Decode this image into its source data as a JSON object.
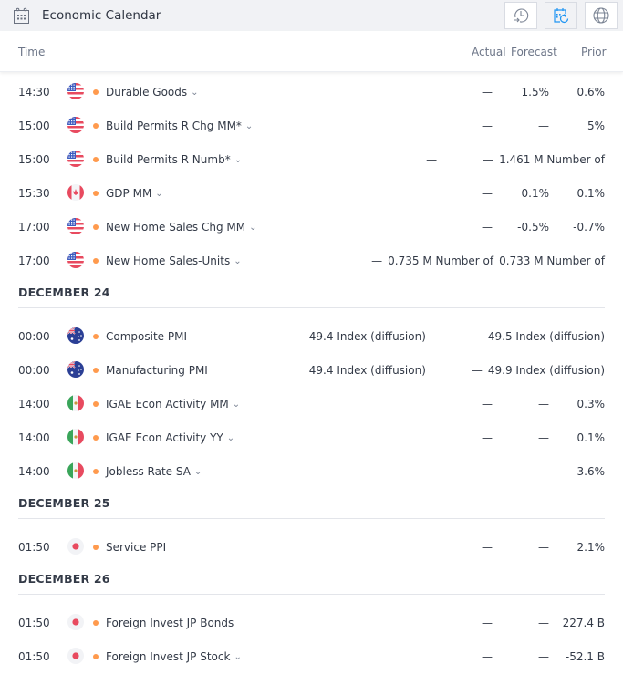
{
  "header": {
    "title": "Economic Calendar",
    "buttons": [
      {
        "name": "history",
        "icon": "history-icon"
      },
      {
        "name": "calendar-refresh",
        "icon": "calendar-refresh-icon",
        "active": true
      },
      {
        "name": "globe",
        "icon": "globe-icon"
      }
    ]
  },
  "columns": {
    "time": "Time",
    "actual": "Actual",
    "forecast": "Forecast",
    "prior": "Prior"
  },
  "colors": {
    "importance_dot": "#ff9a4d",
    "accent": "#2196f3",
    "header_bg": "#f1f2f5"
  },
  "groups": [
    {
      "date": "",
      "events": [
        {
          "time": "14:30",
          "country": "US",
          "name": "Durable Goods",
          "expandable": true,
          "actual": "—",
          "forecast": "1.5%",
          "prior": "0.6%"
        },
        {
          "time": "15:00",
          "country": "US",
          "name": "Build Permits R Chg MM*",
          "expandable": true,
          "actual": "—",
          "forecast": "—",
          "prior": "5%"
        },
        {
          "time": "15:00",
          "country": "US",
          "name": "Build Permits R Numb*",
          "expandable": true,
          "actual": "—",
          "forecast": "—",
          "prior": "1.461 M Number of"
        },
        {
          "time": "15:30",
          "country": "CA",
          "name": "GDP MM",
          "expandable": true,
          "actual": "—",
          "forecast": "0.1%",
          "prior": "0.1%"
        },
        {
          "time": "17:00",
          "country": "US",
          "name": "New Home Sales Chg MM",
          "expandable": true,
          "actual": "—",
          "forecast": "-0.5%",
          "prior": "-0.7%"
        },
        {
          "time": "17:00",
          "country": "US",
          "name": "New Home Sales-Units",
          "expandable": true,
          "actual": "—",
          "forecast": "0.735 M Number of",
          "prior": "0.733 M Number of"
        }
      ]
    },
    {
      "date": "DECEMBER 24",
      "events": [
        {
          "time": "00:00",
          "country": "AU",
          "name": "Composite PMI",
          "expandable": false,
          "actual": "49.4 Index (diffusion)",
          "forecast": "—",
          "prior": "49.5 Index (diffusion)"
        },
        {
          "time": "00:00",
          "country": "AU",
          "name": "Manufacturing PMI",
          "expandable": false,
          "actual": "49.4 Index (diffusion)",
          "forecast": "—",
          "prior": "49.9 Index (diffusion)"
        },
        {
          "time": "14:00",
          "country": "MX",
          "name": "IGAE Econ Activity MM",
          "expandable": true,
          "actual": "—",
          "forecast": "—",
          "prior": "0.3%"
        },
        {
          "time": "14:00",
          "country": "MX",
          "name": "IGAE Econ Activity YY",
          "expandable": true,
          "actual": "—",
          "forecast": "—",
          "prior": "0.1%"
        },
        {
          "time": "14:00",
          "country": "MX",
          "name": "Jobless Rate SA",
          "expandable": true,
          "actual": "—",
          "forecast": "—",
          "prior": "3.6%"
        }
      ]
    },
    {
      "date": "DECEMBER 25",
      "events": [
        {
          "time": "01:50",
          "country": "JP",
          "name": "Service PPI",
          "expandable": false,
          "actual": "—",
          "forecast": "—",
          "prior": "2.1%"
        }
      ]
    },
    {
      "date": "DECEMBER 26",
      "events": [
        {
          "time": "01:50",
          "country": "JP",
          "name": "Foreign Invest JP Bonds",
          "expandable": false,
          "actual": "—",
          "forecast": "—",
          "prior": "227.4 B"
        },
        {
          "time": "01:50",
          "country": "JP",
          "name": "Foreign Invest JP Stock",
          "expandable": true,
          "actual": "—",
          "forecast": "—",
          "prior": "-52.1 B"
        }
      ]
    }
  ]
}
